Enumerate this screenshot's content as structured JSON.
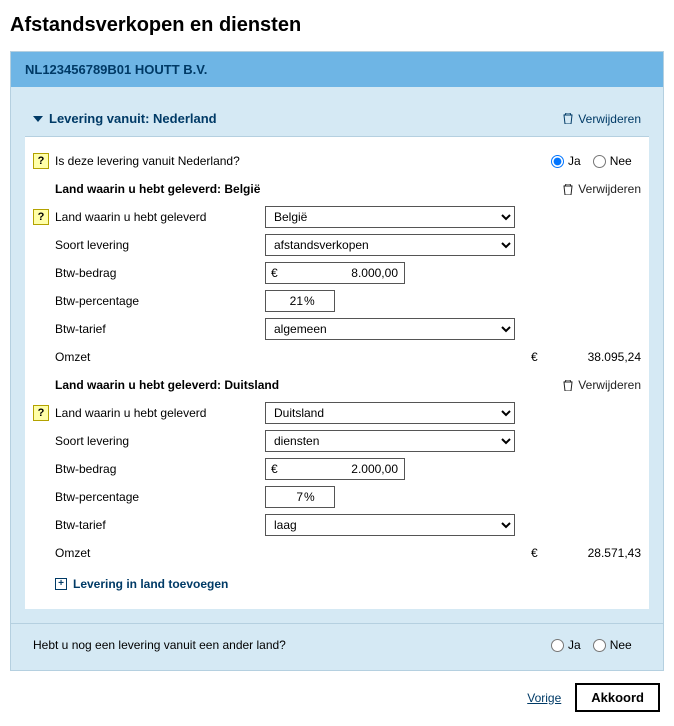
{
  "page_title": "Afstandsverkopen en diensten",
  "company": "NL123456789B01 HOUTT B.V.",
  "verwijderen_label": "Verwijderen",
  "ja": "Ja",
  "nee": "Nee",
  "delivery_from": {
    "prefix": "Levering vanuit:",
    "country": "Nederland"
  },
  "question_from_nl": "Is deze levering vanuit Nederland?",
  "labels": {
    "land_geleverd_hdr": "Land waarin u hebt geleverd:",
    "land_geleverd": "Land waarin u hebt geleverd",
    "soort_levering": "Soort levering",
    "btw_bedrag": "Btw-bedrag",
    "btw_percentage": "Btw-percentage",
    "btw_tarief": "Btw-tarief",
    "omzet": "Omzet",
    "euro": "€",
    "pct": "%"
  },
  "countries": [
    {
      "name": "België",
      "land_select": "België",
      "soort": "afstandsverkopen",
      "bedrag": "8.000,00",
      "pct": "21",
      "tarief": "algemeen",
      "omzet": "38.095,24"
    },
    {
      "name": "Duitsland",
      "land_select": "Duitsland",
      "soort": "diensten",
      "bedrag": "2.000,00",
      "pct": "7",
      "tarief": "laag",
      "omzet": "28.571,43"
    }
  ],
  "add_country": "Levering in land toevoegen",
  "question_other": "Hebt u nog een levering vanuit een ander land?",
  "prev": "Vorige",
  "accept": "Akkoord"
}
